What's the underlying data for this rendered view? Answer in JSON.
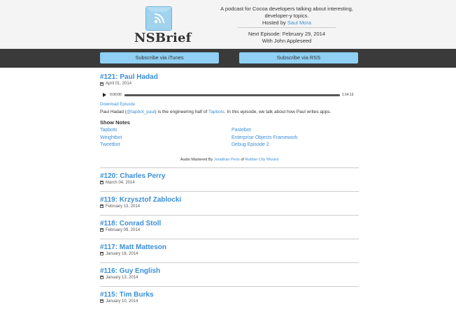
{
  "site": {
    "logo_text": "NSBrief",
    "tagline_1": "A podcast for Cocoa developers talking about interesting,",
    "tagline_2": "developer-y topics.",
    "hosted_by": "Hosted by",
    "host_name": "Saul Mora",
    "next_episode": "Next Episode: February 29, 2014",
    "next_guest": "With John Appleseed"
  },
  "subscribe": {
    "itunes": "Subscribe via iTunes",
    "rss": "Subscribe via RSS"
  },
  "featured": {
    "title": "#121: Paul Hadad",
    "date": "April 01, 2014",
    "player": {
      "current": "0:00:00",
      "duration": "1:14:13",
      "progress": 0
    },
    "download": "Download Episode",
    "desc_a": "Paul Hadad (",
    "desc_handle": "@tapbot_paul",
    "desc_b": ") is the engineering half of ",
    "desc_company": "Tapbots",
    "desc_c": ". In this episode, we talk about how Paul writes apps.",
    "notes_heading": "Show Notes",
    "notes_left": [
      "Tapbots",
      "Weightbot",
      "Tweetbot"
    ],
    "notes_right": [
      "Pastebot",
      "Enterprise Objects Framework",
      "Debug Episode 2"
    ],
    "mastered_a": "Audio Mastered By ",
    "mastered_name": "Jonathan Penn",
    "mastered_of": " of ",
    "mastered_company": "Rubber City Wizard"
  },
  "episodes": [
    {
      "title": "#120: Charles Perry",
      "date": "March 04, 2014"
    },
    {
      "title": "#119: Krzysztof Zablocki",
      "date": "February 13, 2014"
    },
    {
      "title": "#118: Conrad Stoll",
      "date": "February 09, 2014"
    },
    {
      "title": "#117: Matt Matteson",
      "date": "January 16, 2014"
    },
    {
      "title": "#116: Guy English",
      "date": "January 13, 2014"
    },
    {
      "title": "#115: Tim Burks",
      "date": "January 10, 2014"
    }
  ],
  "colors": {
    "link": "#3a8fd8",
    "bar": "#3a3a3a",
    "button": "#8fd0f4"
  }
}
